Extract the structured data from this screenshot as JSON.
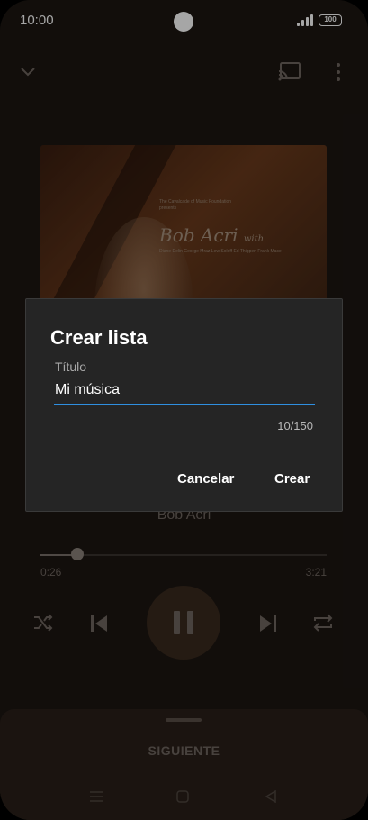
{
  "status_bar": {
    "time": "10:00",
    "battery": "100"
  },
  "album_art": {
    "small_text": "The Cavalcade of Music Foundation presents",
    "artist_name": "Bob Acri",
    "with_text": "with",
    "credits_text": "Diane Delin  George Mraz  Lew Soloff  Ed Thigpen  Frank Mace"
  },
  "player": {
    "artist": "Bob Acri",
    "elapsed": "0:26",
    "total": "3:21",
    "progress": 0.13
  },
  "bottom_sheet": {
    "tab_label": "SIGUIENTE"
  },
  "dialog": {
    "title": "Crear lista",
    "field_label": "Título",
    "field_value": "Mi música",
    "counter": "10/150",
    "cancel_label": "Cancelar",
    "create_label": "Crear"
  },
  "colors": {
    "accent": "#2f8fe0",
    "dialog_bg": "#252525",
    "screen_bg": "#1c1612"
  },
  "icons": [
    "chevron-down-icon",
    "cast-icon",
    "more-vert-icon",
    "shuffle-icon",
    "skip-previous-icon",
    "pause-icon",
    "skip-next-icon",
    "repeat-icon",
    "nav-menu-icon",
    "nav-home-icon",
    "nav-back-icon"
  ]
}
